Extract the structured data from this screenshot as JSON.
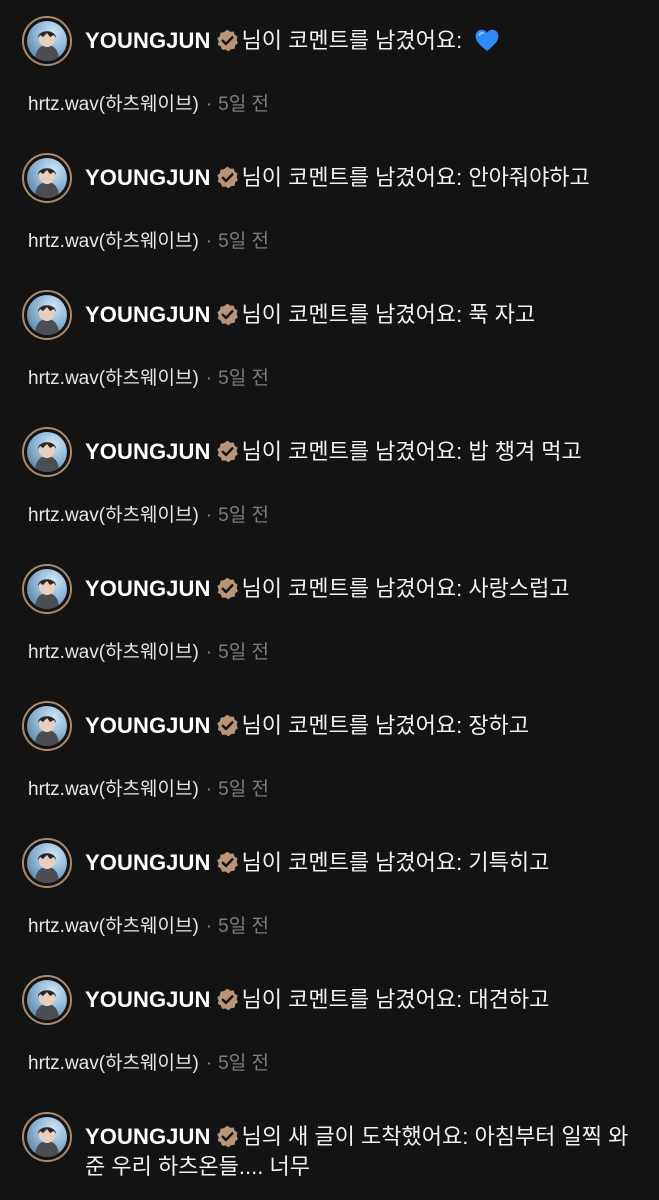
{
  "colors": {
    "background": "#131313",
    "badge": "#b89576",
    "heart": "#2f8cf5",
    "meta": "#7c7c7c"
  },
  "notifications": [
    {
      "username": "YOUNGJUN",
      "message": "님이 코멘트를 남겼어요: ",
      "emoji": "blue-heart-icon",
      "channel": "hrtz.wav(하츠웨이브)",
      "time": "5일 전"
    },
    {
      "username": "YOUNGJUN",
      "message": "님이 코멘트를 남겼어요: 안아줘야하고",
      "channel": "hrtz.wav(하츠웨이브)",
      "time": "5일 전"
    },
    {
      "username": "YOUNGJUN",
      "message": "님이 코멘트를 남겼어요: 푹 자고",
      "channel": "hrtz.wav(하츠웨이브)",
      "time": "5일 전"
    },
    {
      "username": "YOUNGJUN",
      "message": "님이 코멘트를 남겼어요: 밥 챙겨 먹고",
      "channel": "hrtz.wav(하츠웨이브)",
      "time": "5일 전"
    },
    {
      "username": "YOUNGJUN",
      "message": "님이 코멘트를 남겼어요: 사랑스럽고",
      "channel": "hrtz.wav(하츠웨이브)",
      "time": "5일 전"
    },
    {
      "username": "YOUNGJUN",
      "message": "님이 코멘트를 남겼어요: 장하고",
      "channel": "hrtz.wav(하츠웨이브)",
      "time": "5일 전"
    },
    {
      "username": "YOUNGJUN",
      "message": "님이 코멘트를 남겼어요: 기특히고",
      "channel": "hrtz.wav(하츠웨이브)",
      "time": "5일 전"
    },
    {
      "username": "YOUNGJUN",
      "message": "님이 코멘트를 남겼어요: 대견하고",
      "channel": "hrtz.wav(하츠웨이브)",
      "time": "5일 전"
    },
    {
      "username": "YOUNGJUN",
      "message": "님의 새 글이 도착했어요: 아침부터 일찍 와준 우리 하츠온들.... 너무"
    }
  ]
}
